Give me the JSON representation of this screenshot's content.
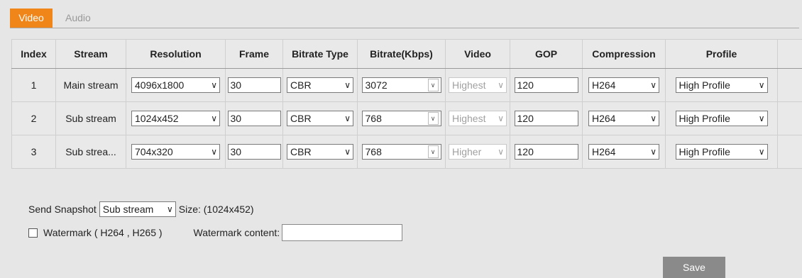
{
  "tabs": {
    "video": "Video",
    "audio": "Audio"
  },
  "table": {
    "headers": [
      "Index",
      "Stream",
      "Resolution",
      "Frame",
      "Bitrate Type",
      "Bitrate(Kbps)",
      "Video",
      "GOP",
      "Compression",
      "Profile"
    ],
    "rows": [
      {
        "index": "1",
        "stream": "Main stream",
        "resolution": "4096x1800",
        "frame": "30",
        "bitrate_type": "CBR",
        "bitrate": "3072",
        "video": "Highest",
        "gop": "120",
        "compression": "H264",
        "profile": "High Profile"
      },
      {
        "index": "2",
        "stream": "Sub stream",
        "resolution": "1024x452",
        "frame": "30",
        "bitrate_type": "CBR",
        "bitrate": "768",
        "video": "Highest",
        "gop": "120",
        "compression": "H264",
        "profile": "High Profile"
      },
      {
        "index": "3",
        "stream": "Sub strea...",
        "resolution": "704x320",
        "frame": "30",
        "bitrate_type": "CBR",
        "bitrate": "768",
        "video": "Higher",
        "gop": "120",
        "compression": "H264",
        "profile": "High Profile"
      }
    ]
  },
  "snapshot": {
    "label": "Send Snapshot",
    "value": "Sub stream",
    "size_text": "Size: (1024x452)"
  },
  "watermark": {
    "label": "Watermark ( H264 , H265 )",
    "content_label": "Watermark content:",
    "content_value": ""
  },
  "save_label": "Save",
  "icons": {
    "dropdown": "chevron-down-icon",
    "checkbox": "checkbox-unchecked-icon"
  },
  "colors": {
    "active_tab": "#f08519",
    "save_button": "#8a8a8a",
    "background": "#e6e6e6"
  }
}
